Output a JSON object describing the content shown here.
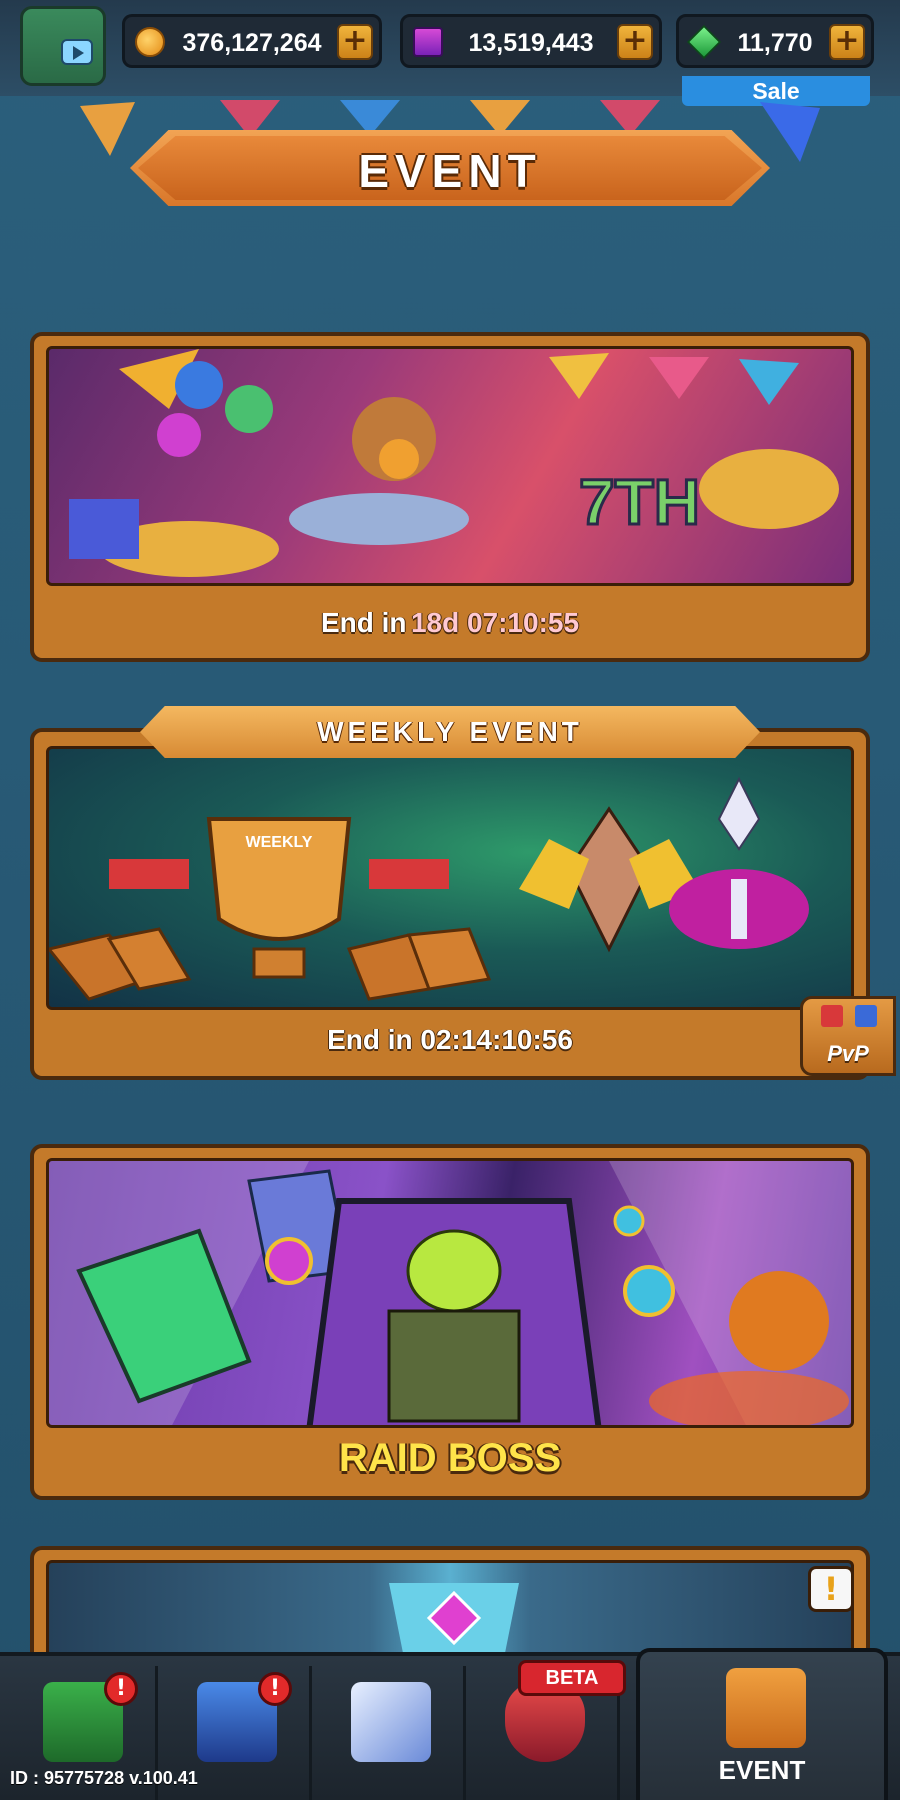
{
  "resources": {
    "coins": "376,127,264",
    "cards": "13,519,443",
    "gems": "11,770",
    "sale_label": "Sale",
    "plus_symbol": "+"
  },
  "header": {
    "title": "EVENT"
  },
  "events": [
    {
      "id": "anniversary",
      "art_text": "7TH",
      "end_prefix": "End in",
      "end_time": "18d 07:10:55"
    },
    {
      "id": "weekly",
      "banner": "WEEKLY EVENT",
      "art_text": "WEEKLY",
      "end_text": "End in 02:14:10:56",
      "side_tab": "PvP"
    },
    {
      "id": "raid",
      "label": "RAID BOSS"
    },
    {
      "id": "upcoming",
      "alert": "!"
    }
  ],
  "bottom_nav": {
    "items": [
      {
        "name": "chest",
        "badge": "!"
      },
      {
        "name": "box",
        "badge": "!"
      },
      {
        "name": "ship"
      },
      {
        "name": "shield",
        "tag": "BETA"
      },
      {
        "name": "event",
        "label": "EVENT"
      }
    ]
  },
  "footer": {
    "id_text": "ID : 95775728 v.100.41"
  },
  "colors": {
    "background": "#2b5f7c",
    "card": "#c47a2a",
    "accent_yellow": "#ffe44a",
    "timer_pink": "#ffc9d2",
    "sale_blue": "#2a8ee0",
    "notif_red": "#e22a2a"
  },
  "icons": {
    "coin": "coin-icon",
    "card": "card-icon",
    "gem": "gem-icon",
    "plus": "plus-icon"
  }
}
